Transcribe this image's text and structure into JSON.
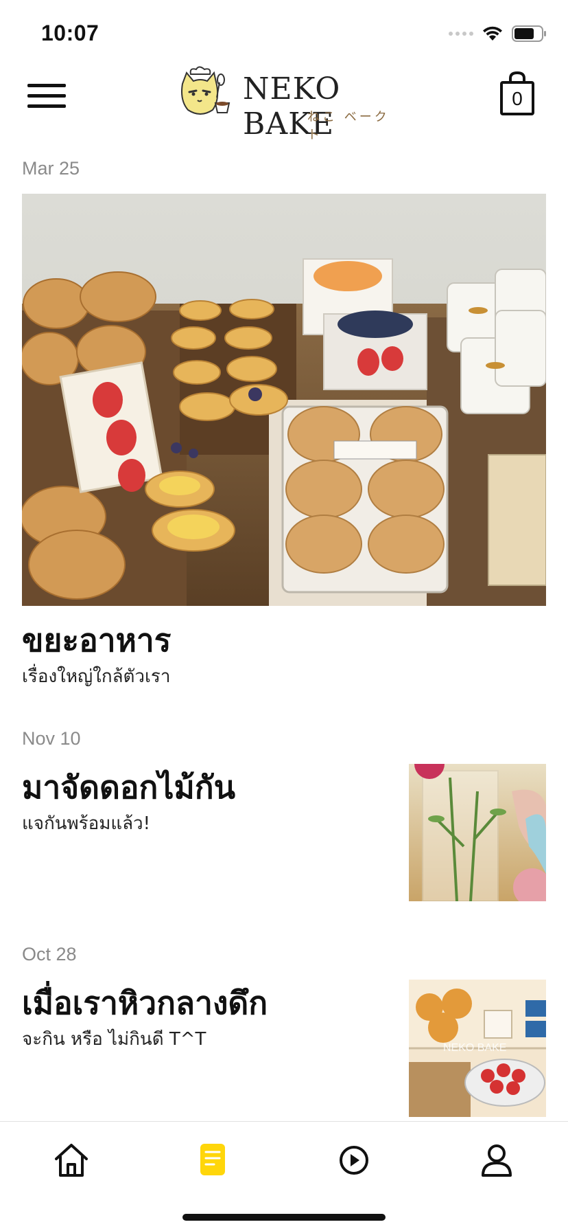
{
  "status": {
    "time": "10:07"
  },
  "header": {
    "menu_icon": "hamburger-icon",
    "logo_text": "NEKO BAKE",
    "logo_subtext": "ねこ ベークト",
    "cart_icon": "shopping-bag-icon",
    "cart_count": "0"
  },
  "posts": [
    {
      "date": "Mar 25",
      "title": "ขยะอาหาร",
      "subtitle": "เรื่องใหญ่ใกล้ตัวเรา",
      "layout": "hero-image"
    },
    {
      "date": "Nov 10",
      "title": "มาจัดดอกไม้กัน",
      "subtitle": "แจกันพร้อมแล้ว!",
      "layout": "thumbnail"
    },
    {
      "date": "Oct 28",
      "title": "เมื่อเราหิวกลางดึก",
      "subtitle": "จะกิน หรือ ไม่กินดี T^T",
      "layout": "thumbnail",
      "thumb_watermark": "NEKO BAKE"
    }
  ],
  "tabbar": {
    "tabs": [
      {
        "icon": "home-icon",
        "active": false
      },
      {
        "icon": "posts-icon",
        "active": true
      },
      {
        "icon": "play-icon",
        "active": false
      },
      {
        "icon": "profile-icon",
        "active": false
      }
    ],
    "active_color": "#FFD60A"
  }
}
